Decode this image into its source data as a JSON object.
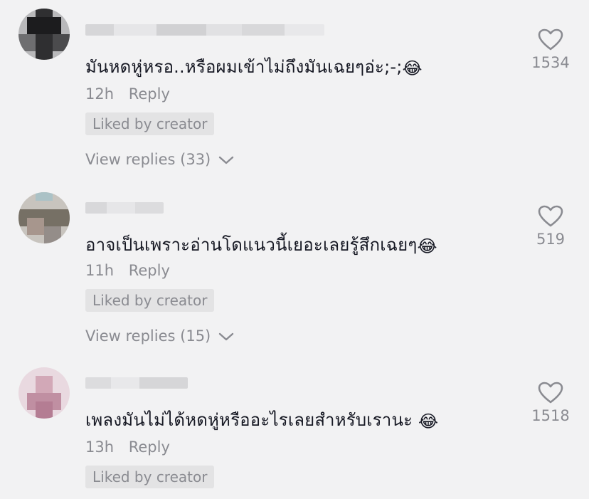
{
  "comments": [
    {
      "text": "มันหดหู่หรอ..หรือผมเข้าไม่ถึงมันเฉยๆอ่ะ;-;",
      "emoji": "😂",
      "time": "12h",
      "reply_label": "Reply",
      "liked_badge": "Liked by creator",
      "view_replies": "View replies (33)",
      "likes": "1534"
    },
    {
      "text": "อาจเป็นเพราะอ่านโดแนวนี้เยอะเลยรู้สึกเฉยๆ",
      "emoji": "😂",
      "time": "11h",
      "reply_label": "Reply",
      "liked_badge": "Liked by creator",
      "view_replies": "View replies (15)",
      "likes": "519"
    },
    {
      "text": "เพลงมันไม่ได้หดหู่หรืออะไรเลยสำหรับเรานะ ",
      "emoji": "😂",
      "time": "13h",
      "reply_label": "Reply",
      "liked_badge": "Liked by creator",
      "likes": "1518"
    }
  ],
  "icons": {
    "like": "heart-outline-icon",
    "expand": "chevron-down-icon"
  },
  "colors": {
    "background": "#f2f2f3",
    "text": "#161823",
    "muted": "#8a8b91",
    "badge_bg": "#e3e3e4"
  }
}
